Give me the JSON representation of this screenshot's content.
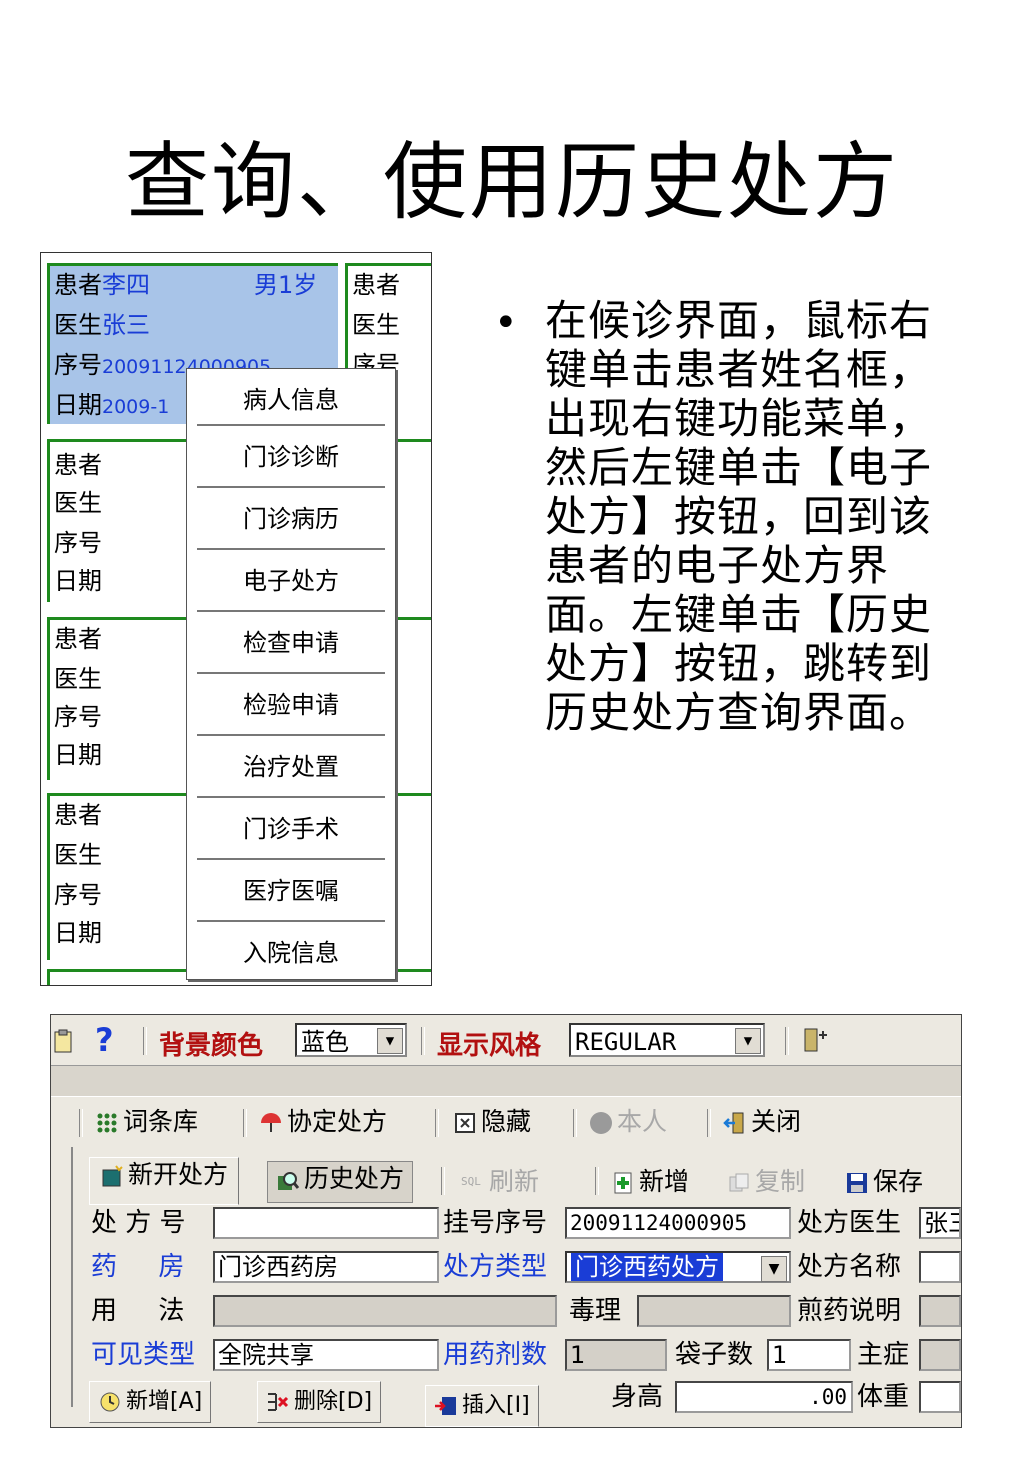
{
  "slide": {
    "title": "查询、使用历史处方",
    "bullet": "在候诊界面，鼠标右键单击患者姓名框，出现右键功能菜单，然后左键单击【电子处方】按钮，回到该患者的电子处方界面。左键单击【历史处方】按钮，跳转到历史处方查询界面。"
  },
  "patient_panel": {
    "selected_card": {
      "patient_label": "患者",
      "patient_name": "李四",
      "gender_age": "男1岁",
      "doctor_label": "医生",
      "doctor_name": "张三",
      "serial_label": "序号",
      "serial_value": "20091124000905",
      "date_label": "日期",
      "date_value": "2009-1"
    },
    "card_labels": [
      "患者",
      "医生",
      "序号",
      "日期"
    ],
    "right_col_labels": [
      "患者",
      "医生",
      "序号"
    ],
    "context_menu": [
      "病人信息",
      "门诊诊断",
      "门诊病历",
      "电子处方",
      "检查申请",
      "检验申请",
      "治疗处置",
      "门诊手术",
      "医疗医嘱",
      "入院信息"
    ]
  },
  "prescription_window": {
    "toolbar1": {
      "bg_color_label": "背景颜色",
      "bg_color_value": "蓝色",
      "style_label": "显示风格",
      "style_value": "REGULAR"
    },
    "toolbar2": {
      "terms": "词条库",
      "agreement": "协定处方",
      "hide": "隐藏",
      "self": "本人",
      "close": "关闭"
    },
    "tabs": {
      "new_rx": "新开处方",
      "history_rx": "历史处方"
    },
    "toolbar3": {
      "refresh": "刷新",
      "add": "新增",
      "copy": "复制",
      "save": "保存"
    },
    "form": {
      "rx_no_label": "处 方 号",
      "rx_no_value": "",
      "reg_no_label": "挂号序号",
      "reg_no_value": "20091124000905",
      "rx_doctor_label": "处方医生",
      "rx_doctor_value": "张三",
      "pharmacy_label": "药     房",
      "pharmacy_value": "门诊西药房",
      "rx_type_label": "处方类型",
      "rx_type_value": "门诊西药处方",
      "rx_name_label": "处方名称",
      "rx_name_value": "",
      "usage_label": "用     法",
      "usage_value": "",
      "toxicity_label": "毒理",
      "toxicity_value": "",
      "decoct_label": "煎药说明",
      "decoct_value": "",
      "visibility_label": "可见类型",
      "visibility_value": "全院共享",
      "doses_label": "用药剂数",
      "doses_value": "1",
      "bags_label": "袋子数",
      "bags_value": "1",
      "symptom_label": "主症",
      "symptom_value": "",
      "height_label": "身高",
      "height_value": ".00",
      "weight_label": "体重",
      "weight_value": ""
    },
    "bottom_buttons": {
      "add": "新增[A]",
      "delete": "删除[D]",
      "insert": "插入[I]"
    }
  }
}
